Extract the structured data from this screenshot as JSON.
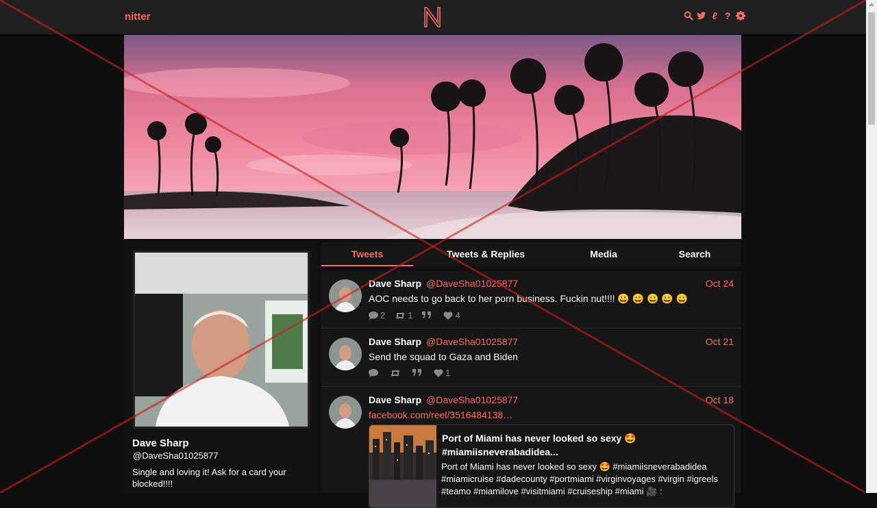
{
  "navbar": {
    "brand": "nitter",
    "logo_letter": "N",
    "icons": [
      "search-icon",
      "twitter-bird-icon",
      "rss-icon",
      "help-icon",
      "settings-gear-icon"
    ]
  },
  "profile": {
    "fullname": "Dave Sharp",
    "username": "@DaveSha01025877",
    "bio": "Single and loving it! Ask for a card your blocked!!!!"
  },
  "tabs": [
    {
      "label": "Tweets",
      "active": true
    },
    {
      "label": "Tweets & Replies",
      "active": false
    },
    {
      "label": "Media",
      "active": false
    },
    {
      "label": "Search",
      "active": false
    }
  ],
  "tweets": [
    {
      "fullname": "Dave Sharp",
      "username": "@DaveSha01025877",
      "date": "Oct 24",
      "text": "AOC needs to go back to her porn business. Fuckin nut!!!! 😀 😀 😀 😀 😀",
      "replies": "2",
      "retweets": "1",
      "quotes": "",
      "likes": "4"
    },
    {
      "fullname": "Dave Sharp",
      "username": "@DaveSha01025877",
      "date": "Oct 21",
      "text": "Send the squad to Gaza and Biden",
      "replies": "",
      "retweets": "",
      "quotes": "",
      "likes": "1"
    },
    {
      "fullname": "Dave Sharp",
      "username": "@DaveSha01025877",
      "date": "Oct 18",
      "link": "facebook.com/reel/3516484138…",
      "card": {
        "title": "Port of Miami has never looked so sexy 🤩 #miamiisneverabadidea...",
        "description": "Port of Miami has never looked so sexy 🤩 #miamiisneverabadidea #miamicruise #dadecounty #portmiami #virginvoyages #virgin #igreels #teamo #miamilove #visitmiami #cruiseship #miami 🎥 :"
      }
    }
  ],
  "colors": {
    "accent": "#ff6c60",
    "background": "#0f0f0f",
    "panel": "#161616",
    "navbar": "#1f1f1f",
    "overlay_x": "#c81e1e"
  }
}
